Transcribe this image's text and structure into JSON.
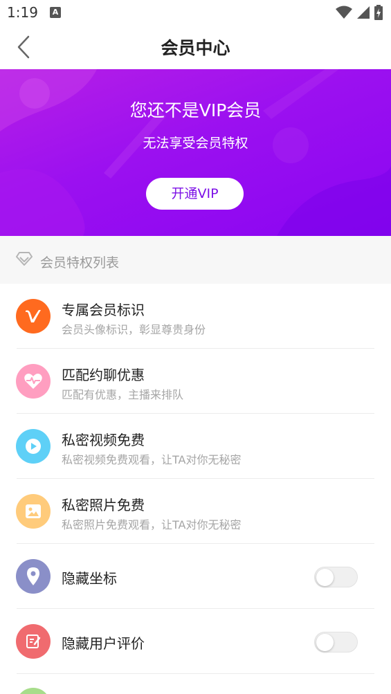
{
  "status_bar": {
    "time": "1:19",
    "notification_letter": "A"
  },
  "header": {
    "title": "会员中心"
  },
  "banner": {
    "title": "您还不是VIP会员",
    "subtitle": "无法享受会员特权",
    "button_label": "开通VIP"
  },
  "section": {
    "title": "会员特权列表"
  },
  "privileges": [
    {
      "title": "专属会员标识",
      "desc": "会员头像标识，彰显尊贵身份",
      "icon": "v-badge-icon",
      "color": "#ff6a1f",
      "icon_letter": "V"
    },
    {
      "title": "匹配约聊优惠",
      "desc": "匹配有优惠，主播来排队",
      "icon": "heartbeat-icon",
      "color": "#ff9ec0"
    },
    {
      "title": "私密视频免费",
      "desc": "私密视频免费观看，让TA对你无秘密",
      "icon": "play-icon",
      "color": "#5ed0f7"
    },
    {
      "title": "私密照片免费",
      "desc": "私密照片免费观看，让TA对你无秘密",
      "icon": "image-icon",
      "color": "#ffcb7b"
    },
    {
      "title": "隐藏坐标",
      "icon": "location-pin-icon",
      "color": "#8a8fc8",
      "toggle_on": false
    },
    {
      "title": "隐藏用户评价",
      "icon": "edit-note-icon",
      "color": "#f06b6f",
      "toggle_on": false
    }
  ],
  "colors": {
    "banner_start": "#b61fe6",
    "banner_end": "#8a05f2",
    "accent": "#7c10e6"
  }
}
